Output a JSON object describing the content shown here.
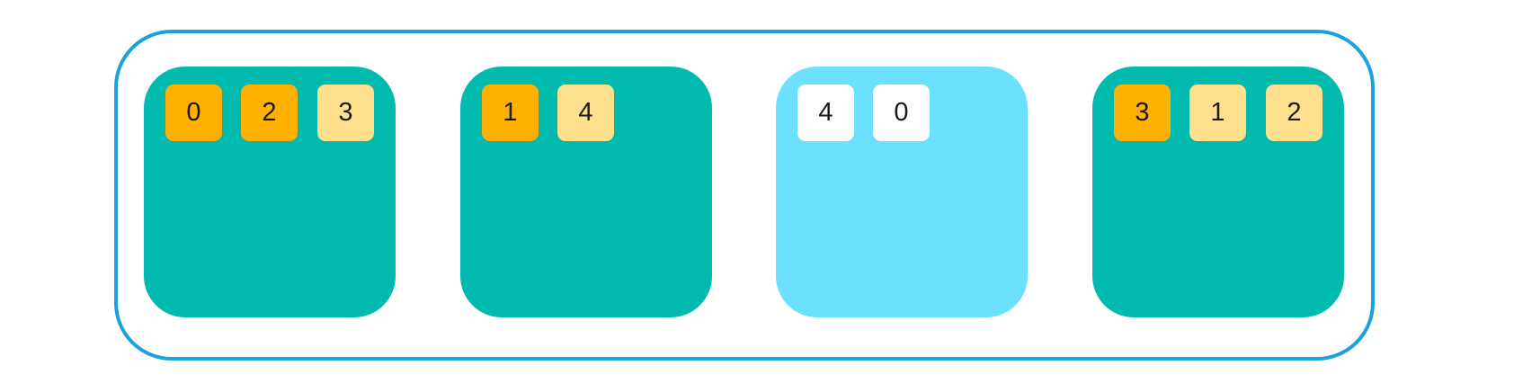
{
  "colors": {
    "frame": "#1ba1e2",
    "group_teal": "#00bbad",
    "group_sky": "#6be0ff",
    "chip_strong": "#ffb000",
    "chip_light": "#ffe08c",
    "chip_white": "#ffffff"
  },
  "groups": [
    {
      "color": "group_teal",
      "chips": [
        {
          "label": "0",
          "color": "chip_strong"
        },
        {
          "label": "2",
          "color": "chip_strong"
        },
        {
          "label": "3",
          "color": "chip_light"
        }
      ]
    },
    {
      "color": "group_teal",
      "chips": [
        {
          "label": "1",
          "color": "chip_strong"
        },
        {
          "label": "4",
          "color": "chip_light"
        }
      ]
    },
    {
      "color": "group_sky",
      "chips": [
        {
          "label": "4",
          "color": "chip_white"
        },
        {
          "label": "0",
          "color": "chip_white"
        }
      ]
    },
    {
      "color": "group_teal",
      "chips": [
        {
          "label": "3",
          "color": "chip_strong"
        },
        {
          "label": "1",
          "color": "chip_light"
        },
        {
          "label": "2",
          "color": "chip_light"
        }
      ]
    }
  ]
}
